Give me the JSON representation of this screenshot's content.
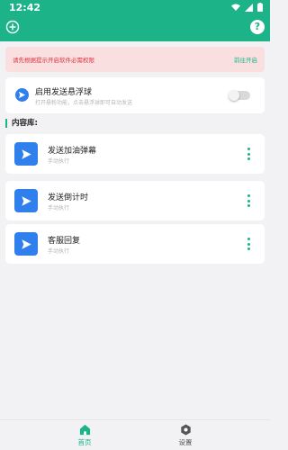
{
  "status_bar": {
    "time": "12:42",
    "icons": [
      "wifi-icon",
      "signal-icon",
      "battery-icon"
    ]
  },
  "toolbar": {
    "left_icon": "add-circle-icon",
    "right_icon": "help-icon",
    "help_glyph": "?"
  },
  "alert": {
    "text": "请先根据提示开启软件必需权限",
    "link": "前往开启",
    "color": "#d9363e"
  },
  "float_ball": {
    "title": "启用发送悬浮球",
    "subtitle": "打开悬粉功能，点击悬浮球即可自动发送",
    "enabled": false
  },
  "content": {
    "section_title": "内容库:",
    "items": [
      {
        "title": "发送加油弹幕",
        "subtitle": "手动执行"
      },
      {
        "title": "发送倒计时",
        "subtitle": "手动执行"
      },
      {
        "title": "客服回复",
        "subtitle": "手动执行"
      }
    ]
  },
  "bottom_nav": {
    "items": [
      {
        "label": "首页",
        "icon": "home-icon",
        "active": true
      },
      {
        "label": "设置",
        "icon": "settings-icon",
        "active": false
      }
    ]
  },
  "colors": {
    "accent": "#1bb387",
    "item_icon": "#2f80ed",
    "background": "#f2f2f4"
  }
}
